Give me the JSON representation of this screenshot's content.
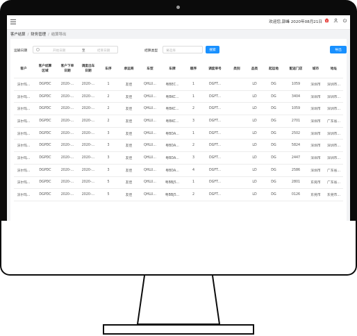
{
  "header": {
    "greeting": "欢迎您,郭峰 2020年08月21日",
    "brand_color": "#e53935"
  },
  "breadcrumb": [
    "客户结算",
    "财务管理",
    "结算导出"
  ],
  "filters": {
    "date_label": "运输日期",
    "start_placeholder": "开始日期",
    "to_label": "至",
    "end_placeholder": "结束日期",
    "type_label": "结算类型",
    "type_placeholder": "请选择",
    "search_button": "搜索",
    "export_button": "导出",
    "accent_color": "#1890ff"
  },
  "table": {
    "columns": [
      "客户",
      "客户结算\n区域",
      "客户下单\n日期",
      "调度出车\n日期",
      "车序",
      "承运商",
      "车型",
      "车牌",
      "顺序",
      "调度单号",
      "类别",
      "品类",
      "起运地",
      "配送门店",
      "城市",
      "地址"
    ],
    "rows": [
      [
        "沃尔玛...",
        "DGPDC",
        "2020-...",
        "2020-...",
        "1",
        "友佳",
        "QHLU...",
        "粤BEC...",
        "1",
        "DGFT...",
        "",
        "LD",
        "DG",
        "1059",
        "深圳市",
        "深圳市..."
      ],
      [
        "沃尔玛...",
        "DGPDC",
        "2020-...",
        "2020-...",
        "2",
        "友佳",
        "QHLU...",
        "粤BKC...",
        "1",
        "DGFT...",
        "",
        "LD",
        "DG",
        "3404",
        "深圳市",
        "深圳市..."
      ],
      [
        "沃尔玛...",
        "DGPDC",
        "2020-...",
        "2020-...",
        "2",
        "友佳",
        "QHLU...",
        "粤BKC...",
        "2",
        "DGFT...",
        "",
        "LD",
        "DG",
        "1059",
        "深圳市",
        "深圳市..."
      ],
      [
        "沃尔玛...",
        "DGPDC",
        "2020-...",
        "2020-...",
        "2",
        "友佳",
        "QHLU...",
        "粤BKC...",
        "3",
        "DGFT...",
        "",
        "LD",
        "DG",
        "2701",
        "深圳市",
        "广东省..."
      ],
      [
        "沃尔玛...",
        "DGPDC",
        "2020-...",
        "2020-...",
        "3",
        "友佳",
        "QHLU...",
        "粤BDA...",
        "1",
        "DGFT...",
        "",
        "LD",
        "DG",
        "2502",
        "深圳市",
        "深圳市..."
      ],
      [
        "沃尔玛...",
        "DGPDC",
        "2020-...",
        "2020-...",
        "3",
        "友佳",
        "QHLU...",
        "粤BDA...",
        "2",
        "DGFT...",
        "",
        "LD",
        "DG",
        "5824",
        "深圳市",
        "深圳市..."
      ],
      [
        "沃尔玛...",
        "DGPDC",
        "2020-...",
        "2020-...",
        "3",
        "友佳",
        "QHLU...",
        "粤BDA...",
        "3",
        "DGFT...",
        "",
        "LD",
        "DG",
        "2447",
        "深圳市",
        "深圳市..."
      ],
      [
        "沃尔玛...",
        "DGPDC",
        "2020-...",
        "2020-...",
        "3",
        "友佳",
        "QHLU...",
        "粤BDA...",
        "4",
        "DGFT...",
        "",
        "LD",
        "DG",
        "2586",
        "深圳市",
        "广东省..."
      ],
      [
        "沃尔玛...",
        "DGPDC",
        "2020-...",
        "2020-...",
        "5",
        "友佳",
        "QHLU...",
        "粤BBJ5...",
        "1",
        "DGFT...",
        "",
        "LD",
        "DG",
        "2801",
        "东莞市",
        "广东省..."
      ],
      [
        "沃尔玛...",
        "DGPDC",
        "2020-...",
        "2020-...",
        "5",
        "友佳",
        "QHLU...",
        "粤BBJ5...",
        "2",
        "DGFT...",
        "",
        "LD",
        "DG",
        "0126",
        "东莞市",
        "东莞市..."
      ]
    ]
  }
}
